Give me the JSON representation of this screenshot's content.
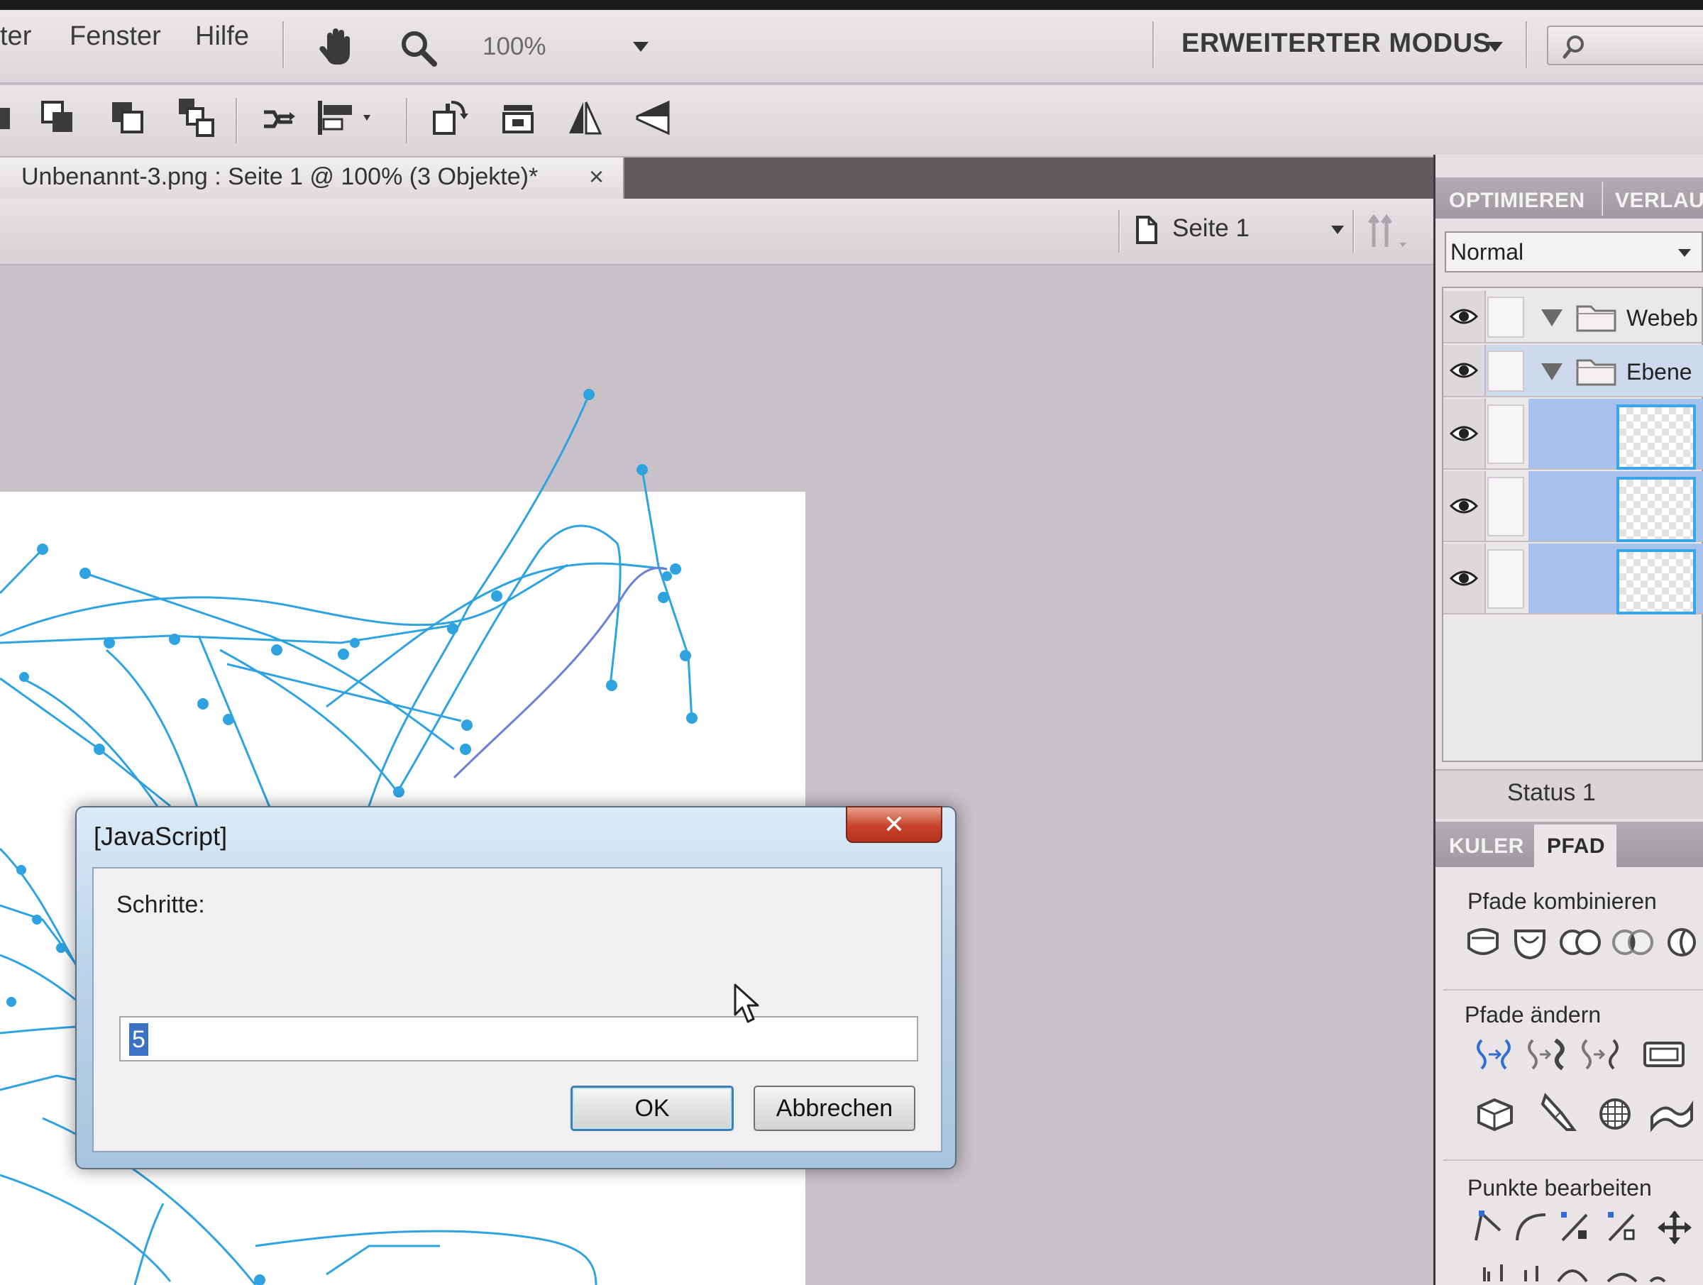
{
  "menu": {
    "items": [
      "ter",
      "Fenster",
      "Hilfe"
    ],
    "zoom": "100%",
    "mode": "ERWEITERTER MODUS"
  },
  "document_tab": {
    "title": "Unbenannt-3.png : Seite 1 @ 100% (3 Objekte)*",
    "close": "×"
  },
  "pagebar": {
    "page": "Seite 1"
  },
  "right_panel": {
    "tabs": [
      "OPTIMIEREN",
      "VERLAU"
    ],
    "blend_mode": "Normal",
    "layers": [
      {
        "name": "Webeb",
        "type": "folder"
      },
      {
        "name": "Ebene",
        "type": "folder"
      },
      {
        "name": "",
        "type": "object"
      },
      {
        "name": "",
        "type": "object"
      },
      {
        "name": "",
        "type": "object"
      }
    ],
    "status": "Status 1",
    "tabs2": [
      "KULER",
      "PFAD"
    ],
    "sections": [
      "Pfade kombinieren",
      "Pfade ändern",
      "Punkte bearbeiten"
    ]
  },
  "dialog": {
    "title": "[JavaScript]",
    "close": "✕",
    "prompt": "Schritte:",
    "input_value": "5",
    "ok_label": "OK",
    "cancel_label": "Abbrechen"
  },
  "colors": {
    "path_stroke": "#2ea3e0",
    "path_stroke_alt": "#6a7fd6",
    "selection": "#3b72c4",
    "thumb_border": "#38a6e8",
    "dialog_close": "#c8432a"
  }
}
